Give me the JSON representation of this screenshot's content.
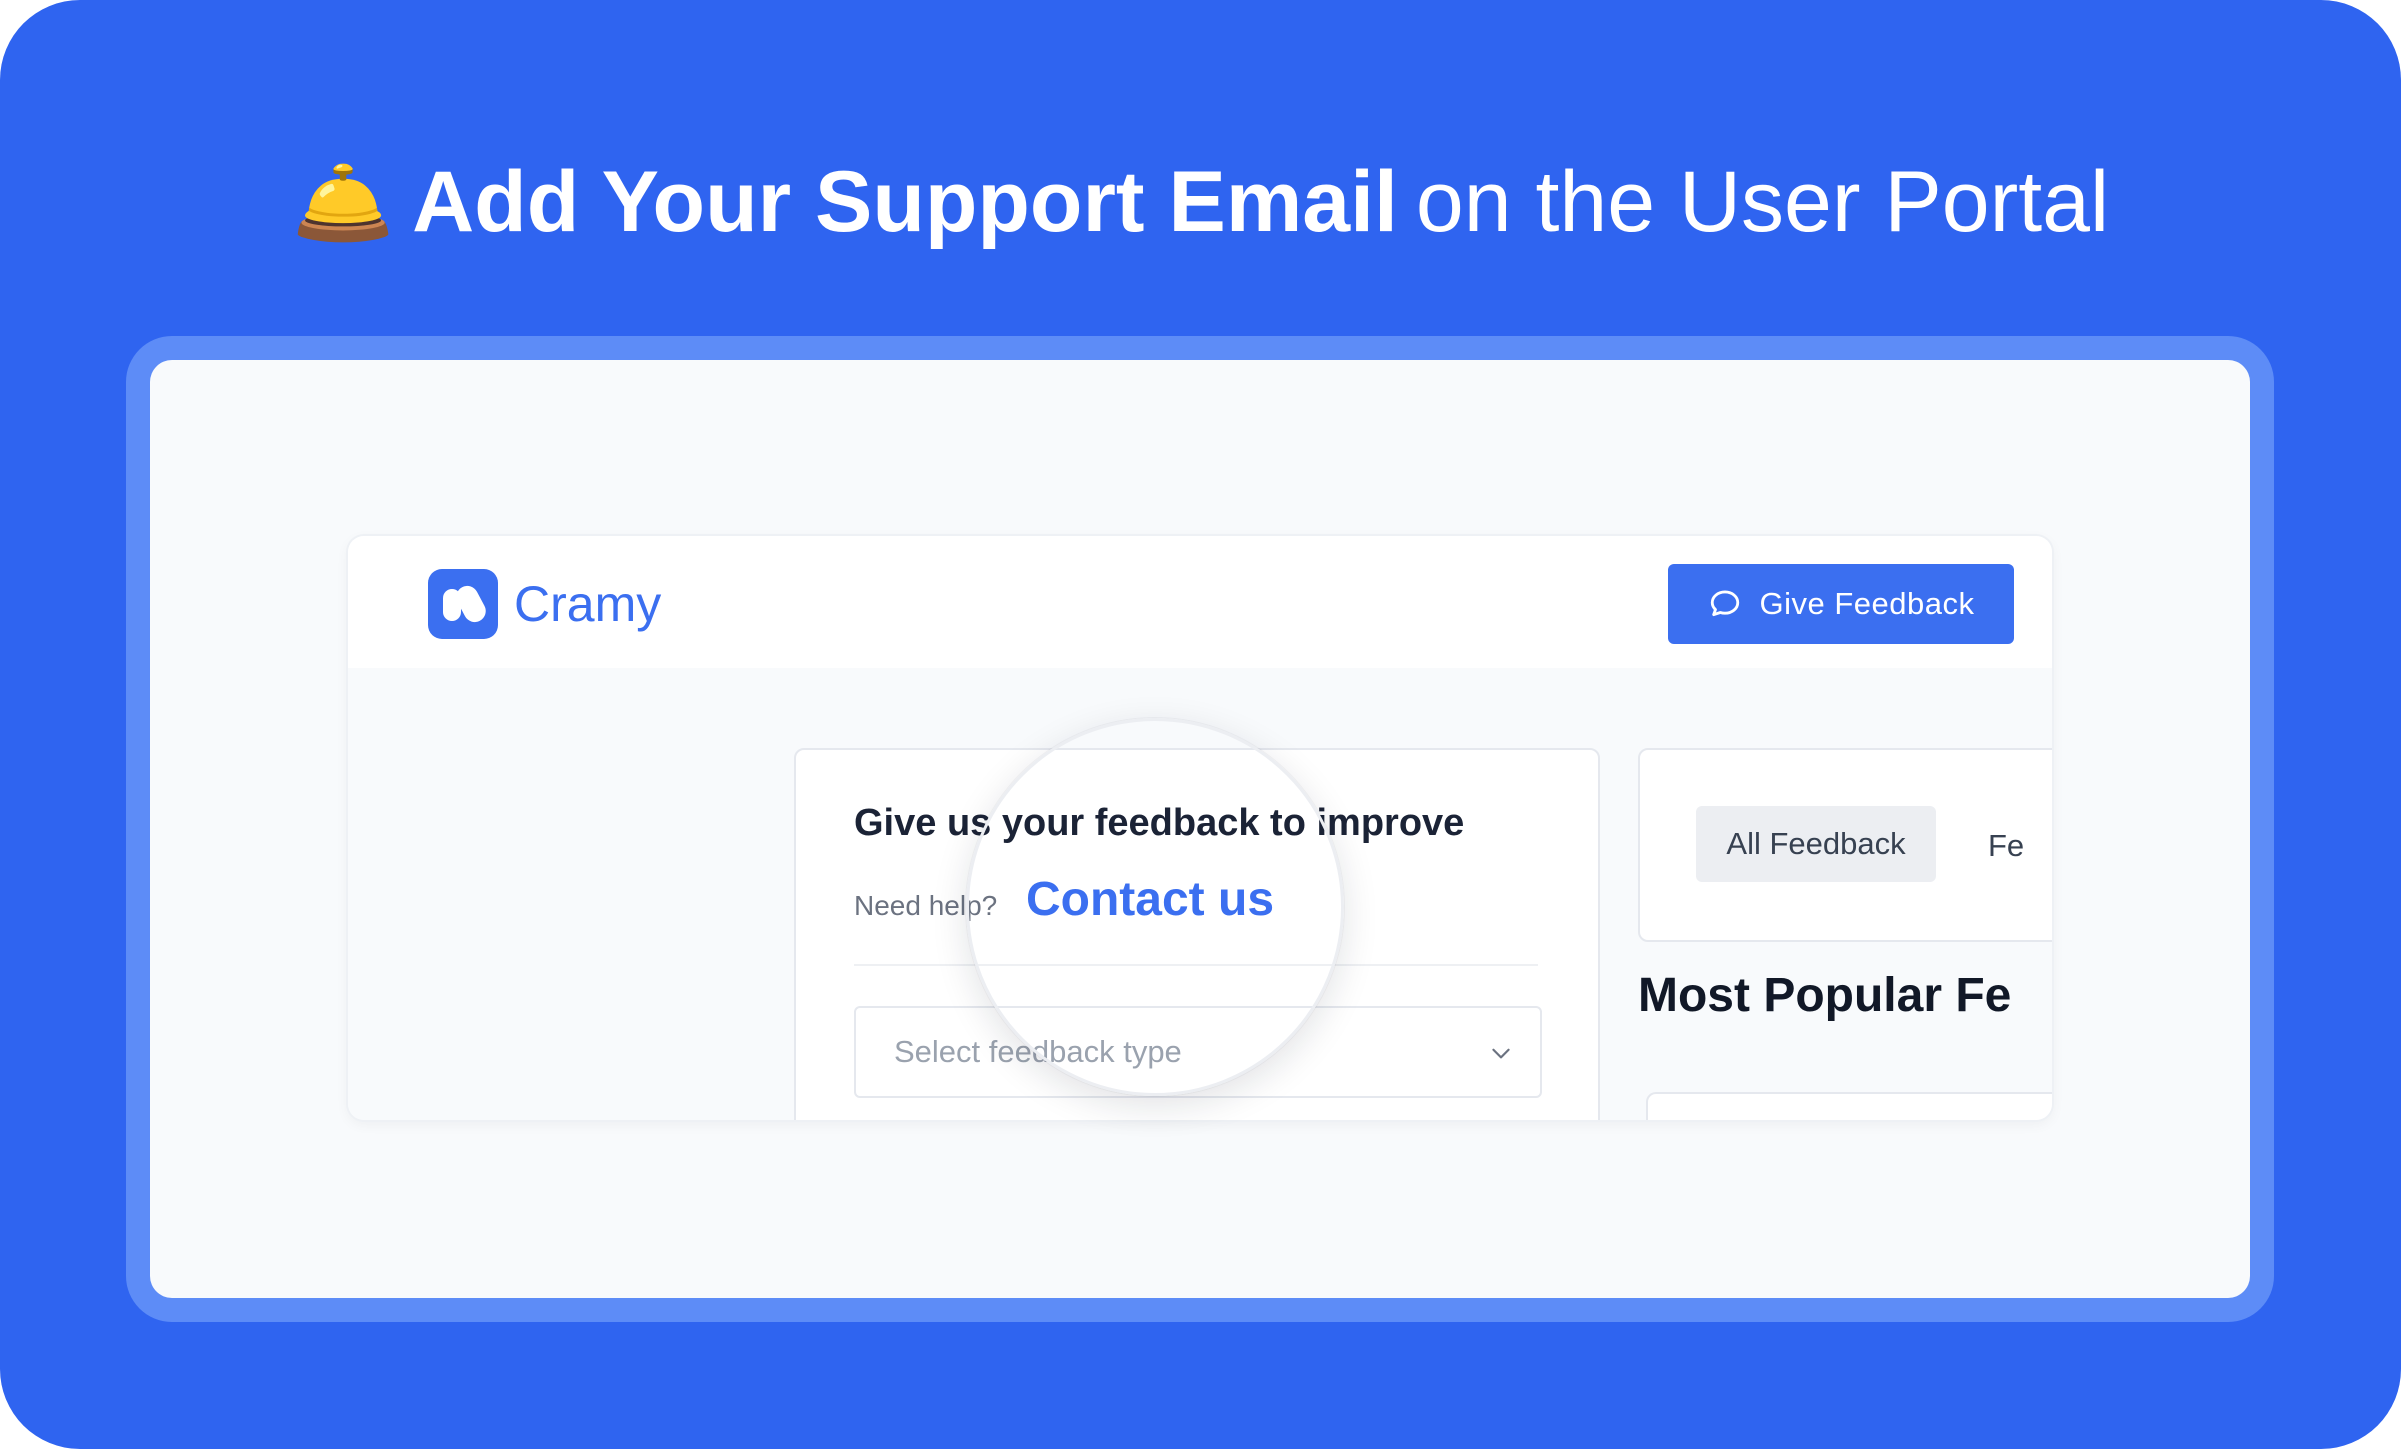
{
  "headline": {
    "icon": "bell-icon",
    "icon_glyph": "🛎️",
    "bold": "Add Your Support Email",
    "regular": "on the User Portal"
  },
  "colors": {
    "banner_blue": "#2f64f0",
    "frame_blue": "#5d8cf7",
    "brand_blue": "#3b6ff0"
  },
  "portal": {
    "logo_text": "Cramy",
    "header_button": "Give Feedback",
    "feedback_card": {
      "title": "Give us your feedback to improve",
      "help_text": "Need help?",
      "contact_link": "Contact us",
      "select_placeholder": "Select feedback type"
    },
    "filters": {
      "active_tab": "All Feedback",
      "next_tab_truncated": "Fe"
    },
    "popular_title": "Most Popular Fe"
  }
}
